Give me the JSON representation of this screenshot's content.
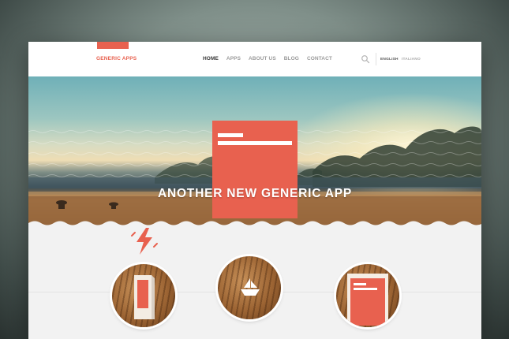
{
  "header": {
    "brand": "GENERIC APPS",
    "nav": [
      "HOME",
      "APPS",
      "ABOUT US",
      "BLOG",
      "CONTACT"
    ],
    "active_nav": "HOME",
    "languages": [
      "ENGLISH",
      "ITALIANO"
    ],
    "active_language": "ENGLISH",
    "search_icon": "search-icon"
  },
  "hero": {
    "title": "ANOTHER NEW GENERIC APP"
  },
  "features": {
    "icons": [
      "lightning-icon",
      "boat-icon",
      "document-icon"
    ]
  },
  "colors": {
    "accent": "#e8614f",
    "background": "#f2f2f2",
    "header": "#ffffff"
  }
}
